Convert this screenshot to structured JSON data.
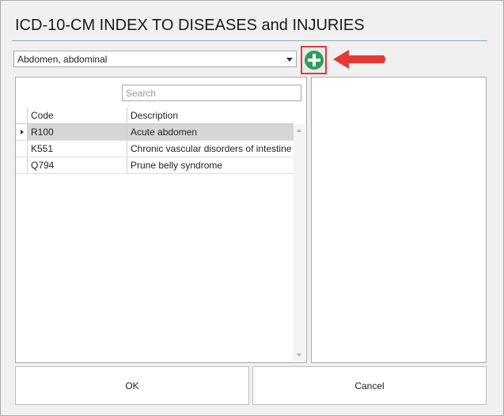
{
  "dialog": {
    "title": "ICD-10-CM INDEX TO DISEASES and INJURIES"
  },
  "dropdown": {
    "selected": "Abdomen, abdominal"
  },
  "add_button": {
    "icon": "plus-circle-icon",
    "color": "#2e9e5b",
    "highlight_color": "#e53935"
  },
  "search": {
    "placeholder": "Search",
    "value": ""
  },
  "table": {
    "columns": [
      "Code",
      "Description"
    ],
    "rows": [
      {
        "code": "R100",
        "description": "Acute abdomen"
      },
      {
        "code": "K551",
        "description": "Chronic vascular disorders of intestine"
      },
      {
        "code": "Q794",
        "description": "Prune belly syndrome"
      }
    ],
    "selected_row": 0
  },
  "buttons": {
    "ok": "OK",
    "cancel": "Cancel"
  },
  "annotation": {
    "arrow_color": "#e53935"
  }
}
